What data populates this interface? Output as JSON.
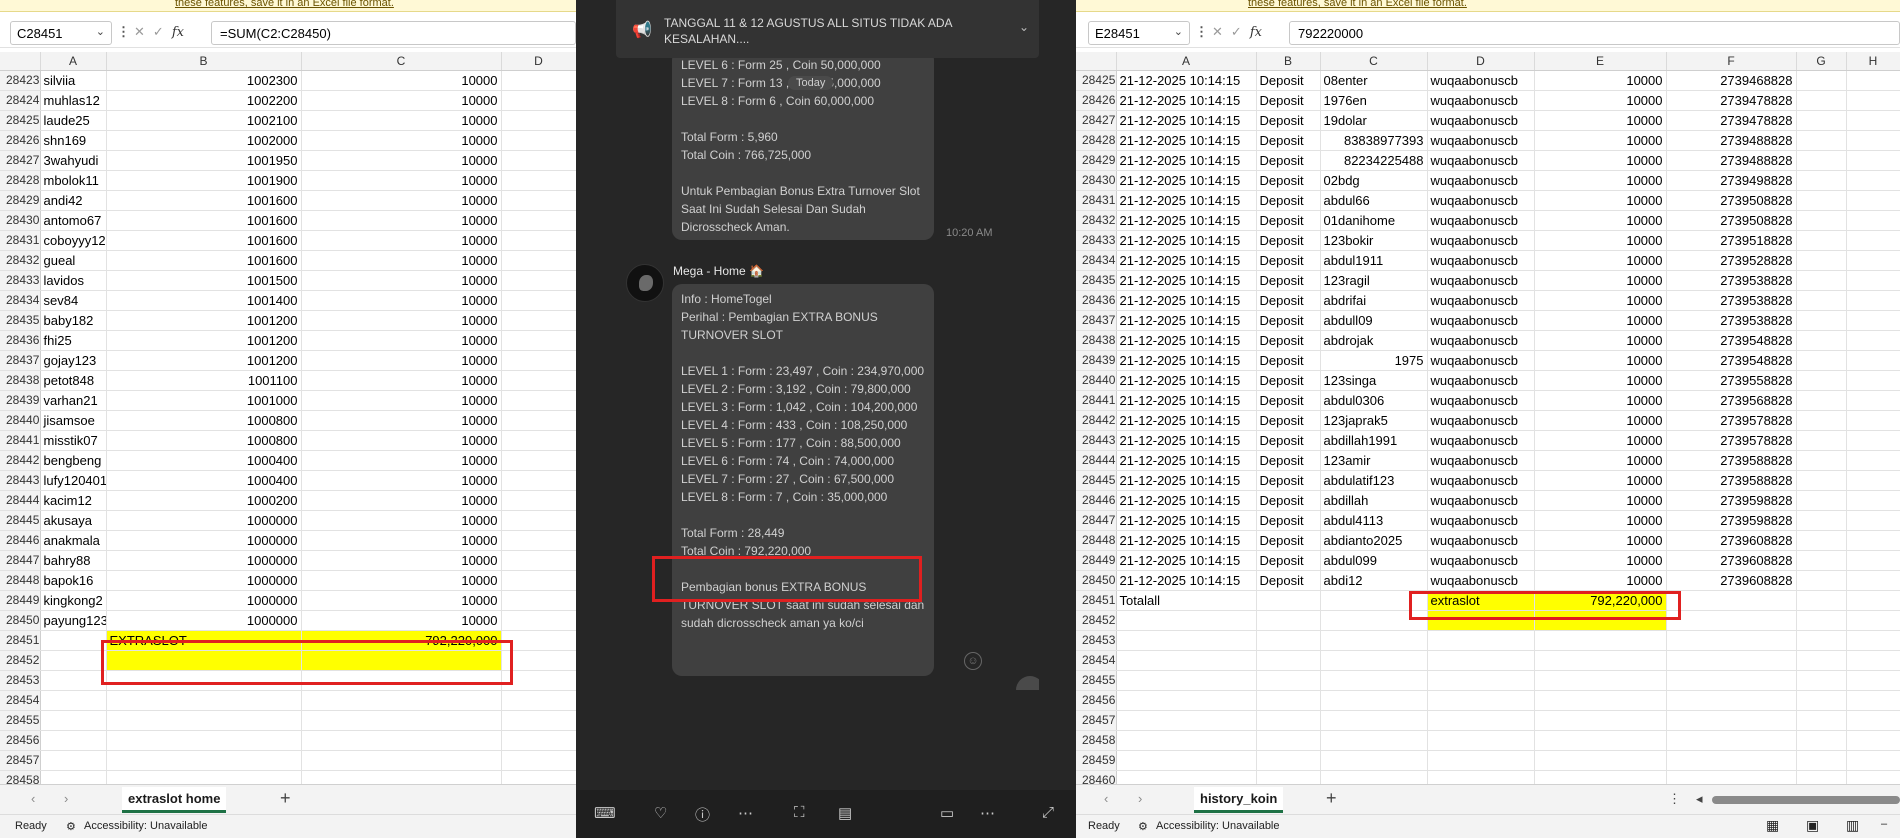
{
  "left": {
    "banner": "these features, save it in an Excel file format.",
    "namebox": "C28451",
    "formula": "=SUM(C2:C28450)",
    "columns": [
      "A",
      "B",
      "C",
      "D"
    ],
    "rows": [
      [
        "28423",
        "silviia",
        "1002300",
        "10000"
      ],
      [
        "28424",
        "muhlas12",
        "1002200",
        "10000"
      ],
      [
        "28425",
        "laude25",
        "1002100",
        "10000"
      ],
      [
        "28426",
        "shn169",
        "1002000",
        "10000"
      ],
      [
        "28427",
        "3wahyudi",
        "1001950",
        "10000"
      ],
      [
        "28428",
        "mbolok11",
        "1001900",
        "10000"
      ],
      [
        "28429",
        "andi42",
        "1001600",
        "10000"
      ],
      [
        "28430",
        "antomo67",
        "1001600",
        "10000"
      ],
      [
        "28431",
        "coboyyy12",
        "1001600",
        "10000"
      ],
      [
        "28432",
        "gueal",
        "1001600",
        "10000"
      ],
      [
        "28433",
        "lavidos",
        "1001500",
        "10000"
      ],
      [
        "28434",
        "sev84",
        "1001400",
        "10000"
      ],
      [
        "28435",
        "baby182",
        "1001200",
        "10000"
      ],
      [
        "28436",
        "fhi25",
        "1001200",
        "10000"
      ],
      [
        "28437",
        "gojay123",
        "1001200",
        "10000"
      ],
      [
        "28438",
        "petot848",
        "1001100",
        "10000"
      ],
      [
        "28439",
        "varhan21",
        "1001000",
        "10000"
      ],
      [
        "28440",
        "jisamsoe",
        "1000800",
        "10000"
      ],
      [
        "28441",
        "misstik07",
        "1000800",
        "10000"
      ],
      [
        "28442",
        "bengbeng",
        "1000400",
        "10000"
      ],
      [
        "28443",
        "lufy120401",
        "1000400",
        "10000"
      ],
      [
        "28444",
        "kacim12",
        "1000200",
        "10000"
      ],
      [
        "28445",
        "akusaya",
        "1000000",
        "10000"
      ],
      [
        "28446",
        "anakmala",
        "1000000",
        "10000"
      ],
      [
        "28447",
        "bahry88",
        "1000000",
        "10000"
      ],
      [
        "28448",
        "bapok16",
        "1000000",
        "10000"
      ],
      [
        "28449",
        "kingkong2",
        "1000000",
        "10000"
      ],
      [
        "28450",
        "payung123",
        "1000000",
        "10000"
      ]
    ],
    "total_row": {
      "num": "28451",
      "label": "EXTRASLOT",
      "value": "792,220,000"
    },
    "empty_rows": [
      "28452",
      "28453",
      "28454",
      "28455",
      "28456",
      "28457",
      "28458"
    ],
    "sheet_tab": "extraslot home",
    "status_ready": "Ready",
    "status_access": "Accessibility: Unavailable"
  },
  "mid": {
    "announcement": "TANGGAL 11 & 12 AGUSTUS ALL SITUS TIDAK ADA KESALAHAN....",
    "today": "Today",
    "msg1": "LEVEL 6 : Form 25 , Coin 50,000,000\nLEVEL 7 : Form 13 , Coin 65,000,000\nLEVEL 8 : Form 6 , Coin 60,000,000\n\nTotal Form : 5,960\nTotal Coin : 766,725,000\n\nUntuk Pembagian Bonus Extra Turnover Slot Saat Ini Sudah Selesai Dan Sudah Dicrosscheck Aman.",
    "msg1_time": "10:20 AM",
    "sender": "Mega - Home 🏠",
    "msg2_head": "Info : HomeTogel\nPerihal : Pembagian EXTRA BONUS TURNOVER SLOT\n\nLEVEL 1 : Form : 23,497 , Coin : 234,970,000\nLEVEL 2 : Form : 3,192 , Coin : 79,800,000\nLEVEL 3 : Form : 1,042 , Coin : 104,200,000\nLEVEL 4 : Form : 433 , Coin : 108,250,000\nLEVEL 5 : Form : 177 , Coin : 88,500,000\nLEVEL 6 : Form : 74 , Coin : 74,000,000\nLEVEL 7 : Form : 27 , Coin : 67,500,000\nLEVEL 8 : Form : 7 , Coin : 35,000,000",
    "msg2_total": "Total Form : 28,449\nTotal Coin : 792,220,000",
    "msg2_tail": "Pembagian bonus EXTRA BONUS TURNOVER SLOT saat ini sudah selesai dan sudah dicrosscheck aman ya ko/ci"
  },
  "right": {
    "banner": "these features, save it in an Excel file format.",
    "namebox": "E28451",
    "formula": "792220000",
    "columns": [
      "A",
      "B",
      "C",
      "D",
      "E",
      "F",
      "G",
      "H"
    ],
    "rows": [
      [
        "28425",
        "21-12-2025 10:14:15",
        "Deposit",
        "08enter",
        "wuqaabonuscb",
        "10000",
        "2739468828"
      ],
      [
        "28426",
        "21-12-2025 10:14:15",
        "Deposit",
        "1976en",
        "wuqaabonuscb",
        "10000",
        "2739478828"
      ],
      [
        "28427",
        "21-12-2025 10:14:15",
        "Deposit",
        "19dolar",
        "wuqaabonuscb",
        "10000",
        "2739478828"
      ],
      [
        "28428",
        "21-12-2025 10:14:15",
        "Deposit",
        "83838977393",
        "wuqaabonuscb",
        "10000",
        "2739488828"
      ],
      [
        "28429",
        "21-12-2025 10:14:15",
        "Deposit",
        "82234225488",
        "wuqaabonuscb",
        "10000",
        "2739488828"
      ],
      [
        "28430",
        "21-12-2025 10:14:15",
        "Deposit",
        "02bdg",
        "wuqaabonuscb",
        "10000",
        "2739498828"
      ],
      [
        "28431",
        "21-12-2025 10:14:15",
        "Deposit",
        "abdul66",
        "wuqaabonuscb",
        "10000",
        "2739508828"
      ],
      [
        "28432",
        "21-12-2025 10:14:15",
        "Deposit",
        "01danihome",
        "wuqaabonuscb",
        "10000",
        "2739508828"
      ],
      [
        "28433",
        "21-12-2025 10:14:15",
        "Deposit",
        "123bokir",
        "wuqaabonuscb",
        "10000",
        "2739518828"
      ],
      [
        "28434",
        "21-12-2025 10:14:15",
        "Deposit",
        "abdul1911",
        "wuqaabonuscb",
        "10000",
        "2739528828"
      ],
      [
        "28435",
        "21-12-2025 10:14:15",
        "Deposit",
        "123ragil",
        "wuqaabonuscb",
        "10000",
        "2739538828"
      ],
      [
        "28436",
        "21-12-2025 10:14:15",
        "Deposit",
        "abdrifai",
        "wuqaabonuscb",
        "10000",
        "2739538828"
      ],
      [
        "28437",
        "21-12-2025 10:14:15",
        "Deposit",
        "abdull09",
        "wuqaabonuscb",
        "10000",
        "2739538828"
      ],
      [
        "28438",
        "21-12-2025 10:14:15",
        "Deposit",
        "abdrojak",
        "wuqaabonuscb",
        "10000",
        "2739548828"
      ],
      [
        "28439",
        "21-12-2025 10:14:15",
        "Deposit",
        "1975",
        "wuqaabonuscb",
        "10000",
        "2739548828"
      ],
      [
        "28440",
        "21-12-2025 10:14:15",
        "Deposit",
        "123singa",
        "wuqaabonuscb",
        "10000",
        "2739558828"
      ],
      [
        "28441",
        "21-12-2025 10:14:15",
        "Deposit",
        "abdul0306",
        "wuqaabonuscb",
        "10000",
        "2739568828"
      ],
      [
        "28442",
        "21-12-2025 10:14:15",
        "Deposit",
        "123japrak5",
        "wuqaabonuscb",
        "10000",
        "2739578828"
      ],
      [
        "28443",
        "21-12-2025 10:14:15",
        "Deposit",
        "abdillah1991",
        "wuqaabonuscb",
        "10000",
        "2739578828"
      ],
      [
        "28444",
        "21-12-2025 10:14:15",
        "Deposit",
        "123amir",
        "wuqaabonuscb",
        "10000",
        "2739588828"
      ],
      [
        "28445",
        "21-12-2025 10:14:15",
        "Deposit",
        "abdulatif123",
        "wuqaabonuscb",
        "10000",
        "2739588828"
      ],
      [
        "28446",
        "21-12-2025 10:14:15",
        "Deposit",
        "abdillah",
        "wuqaabonuscb",
        "10000",
        "2739598828"
      ],
      [
        "28447",
        "21-12-2025 10:14:15",
        "Deposit",
        "abdul4113",
        "wuqaabonuscb",
        "10000",
        "2739598828"
      ],
      [
        "28448",
        "21-12-2025 10:14:15",
        "Deposit",
        "abdianto2025",
        "wuqaabonuscb",
        "10000",
        "2739608828"
      ],
      [
        "28449",
        "21-12-2025 10:14:15",
        "Deposit",
        "abdul099",
        "wuqaabonuscb",
        "10000",
        "2739608828"
      ],
      [
        "28450",
        "21-12-2025 10:14:15",
        "Deposit",
        "abdi12",
        "wuqaabonuscb",
        "10000",
        "2739608828"
      ]
    ],
    "total_row": {
      "num": "28451",
      "label": "Totalall",
      "label2": "extraslot",
      "value": "792,220,000"
    },
    "empty_rows": [
      "28452",
      "28453",
      "28454",
      "28455",
      "28456",
      "28457",
      "28458",
      "28459",
      "28460"
    ],
    "sheet_tab": "history_koin",
    "status_ready": "Ready",
    "status_access": "Accessibility: Unavailable"
  }
}
